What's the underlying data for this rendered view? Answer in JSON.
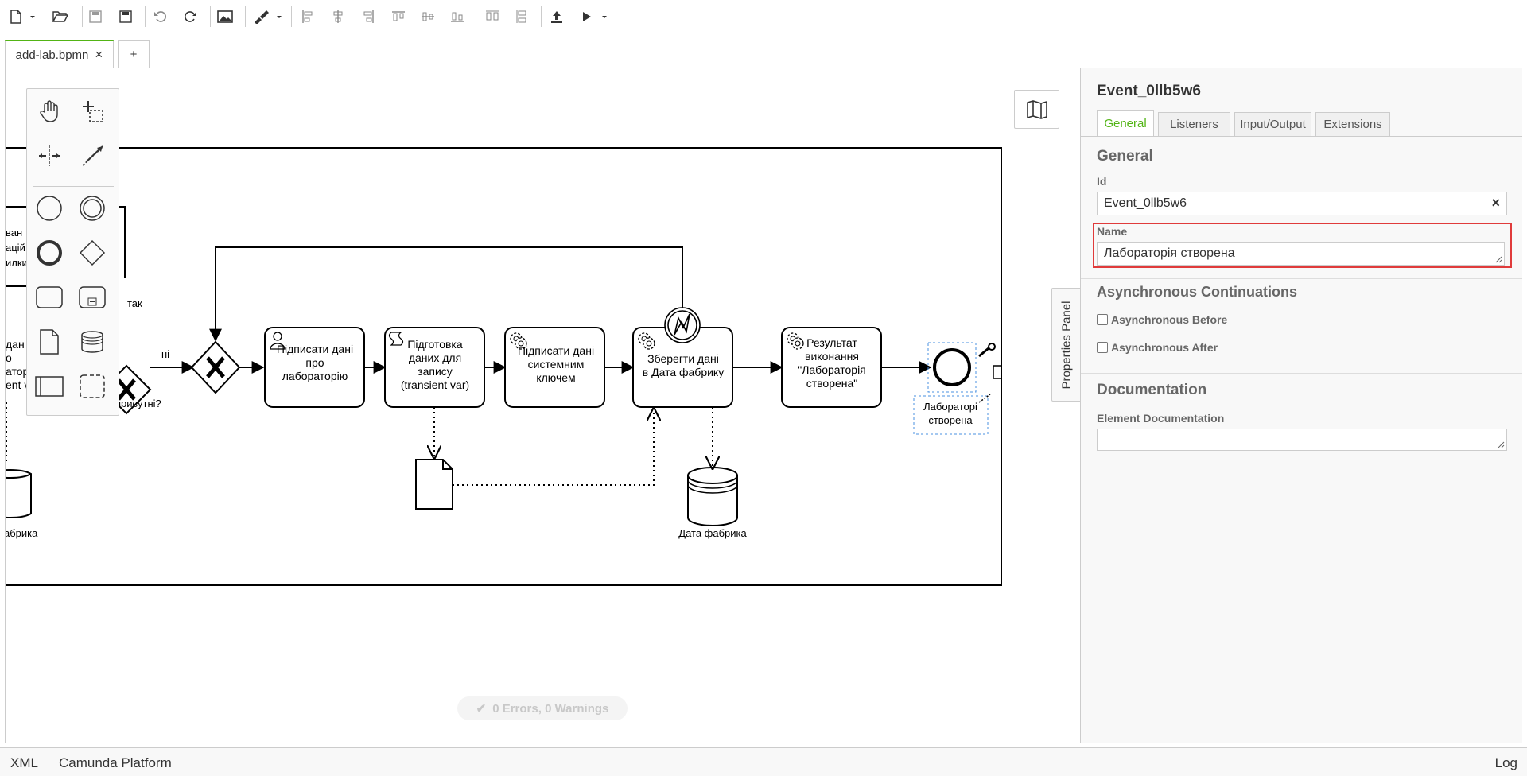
{
  "toolbar": {
    "buttons": [
      "new-file",
      "open",
      "save",
      "save-as",
      "undo",
      "redo",
      "export-image",
      "color",
      "align-left",
      "align-center",
      "align-right",
      "align-top",
      "align-middle",
      "align-bottom",
      "distribute-h",
      "distribute-v",
      "deploy",
      "run"
    ]
  },
  "tabs": {
    "file_tab": "add-lab.bpmn",
    "close_glyph": "×",
    "add_tab": "+"
  },
  "diagram": {
    "labels": {
      "gw1_label_top": "так",
      "gw1_label_no": "ні",
      "gw1_name": "присутні?",
      "left_partial1": "ван",
      "left_partial2": "ацій",
      "left_partial3": "илки",
      "left_partial4": "дан",
      "left_partial5": "о",
      "left_partial6": "атор",
      "left_partial7": "ent v",
      "left_db": "абрика",
      "task1": "Підписати дані про лабораторію",
      "task2": "Підготовка даних для запису (transient var)",
      "task3": "Підписати дані системним ключем",
      "task4": "Зберегти дані в Дата фабрику",
      "task5": "Результат виконання \"Лабораторія створена\"",
      "db2": "Дата фабрика",
      "end_event": "Лабораторія створена"
    }
  },
  "status": {
    "text": "0 Errors, 0 Warnings"
  },
  "properties_toggle": "Properties Panel",
  "properties": {
    "title": "Event_0llb5w6",
    "tabs": [
      "General",
      "Listeners",
      "Input/Output",
      "Extensions"
    ],
    "general_title": "General",
    "id_label": "Id",
    "id_value": "Event_0llb5w6",
    "clear_glyph": "×",
    "name_label": "Name",
    "name_value": "Лабораторія створена",
    "async_title": "Asynchronous Continuations",
    "async_before": "Asynchronous Before",
    "async_after": "Asynchronous After",
    "doc_title": "Documentation",
    "doc_label": "Element Documentation"
  },
  "footer": {
    "xml": "XML",
    "platform": "Camunda Platform",
    "log": "Log"
  }
}
